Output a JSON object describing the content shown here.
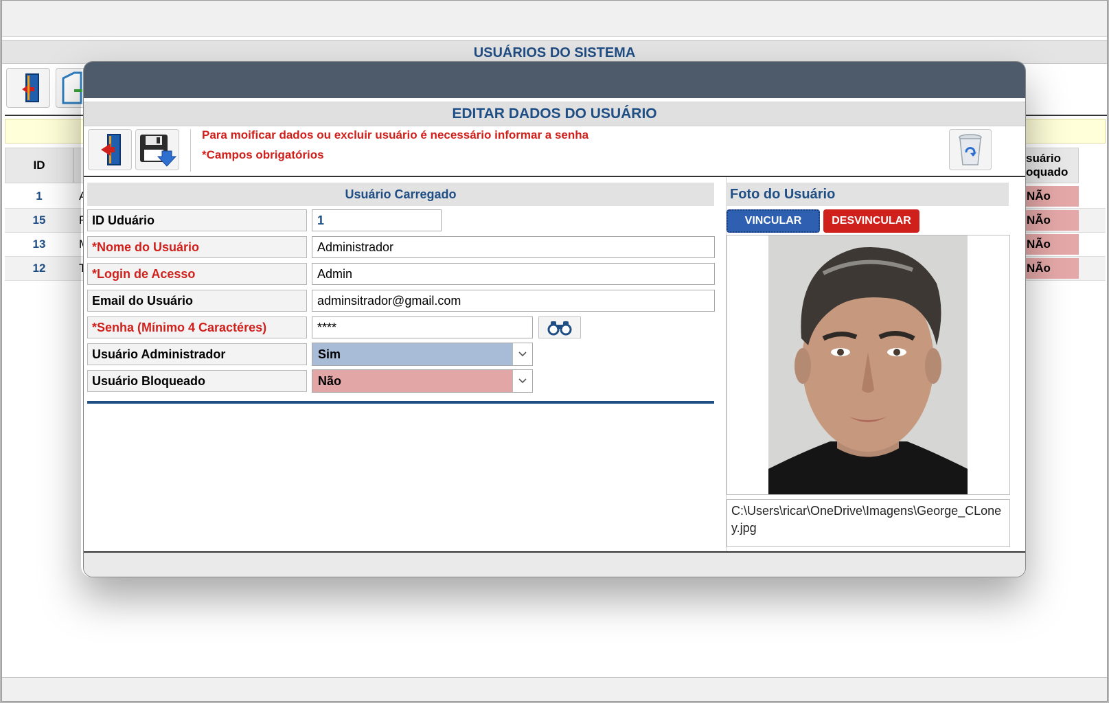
{
  "background": {
    "title": "USUÁRIOS DO SISTEMA",
    "table": {
      "id_header": "ID",
      "right_header_line1": "suário",
      "right_header_line2": "oquado",
      "rows": [
        {
          "id": "1",
          "letter": "A",
          "bloqueado": "NÃo"
        },
        {
          "id": "15",
          "letter": "F",
          "bloqueado": "NÃo"
        },
        {
          "id": "13",
          "letter": "M",
          "bloqueado": "NÃo"
        },
        {
          "id": "12",
          "letter": "T",
          "bloqueado": "NÃo"
        }
      ]
    }
  },
  "modal": {
    "title": "EDITAR DADOS DO USUÁRIO",
    "toolbar": {
      "exit_icon": "exit-door-icon",
      "save_icon": "save-floppy-icon",
      "delete_icon": "recycle-bin-icon"
    },
    "messages": {
      "password_notice": "Para moificar dados ou excluir usuário é necessário informar a senha",
      "required_notice": "*Campos obrigatórios"
    },
    "form": {
      "section_title": "Usuário Carregado",
      "id_label": "ID Uduário",
      "id_value": "1",
      "name_label": "*Nome do Usuário",
      "name_value": "Administrador",
      "login_label": "*Login de Acesso",
      "login_value": "Admin",
      "email_label": "Email do Usuário",
      "email_value": "adminsitrador@gmail.com",
      "password_label": "*Senha (Mínimo 4 Caractéres)",
      "password_value": "****",
      "admin_label": "Usuário Administrador",
      "admin_value": "Sim",
      "blocked_label": "Usuário Bloqueado",
      "blocked_value": "Não"
    },
    "photo": {
      "title": "Foto do Usuário",
      "link_button": "VINCULAR",
      "unlink_button": "DESVINCULAR",
      "path": "C:\\Users\\ricar\\OneDrive\\Imagens\\George_CLoney.jpg"
    }
  },
  "colors": {
    "accent_blue": "#1f4e84",
    "required_red": "#d0201c",
    "modal_header": "#4e5b6b",
    "admin_select_bg": "#a8bcd8",
    "blocked_select_bg": "#e2a6a6"
  }
}
